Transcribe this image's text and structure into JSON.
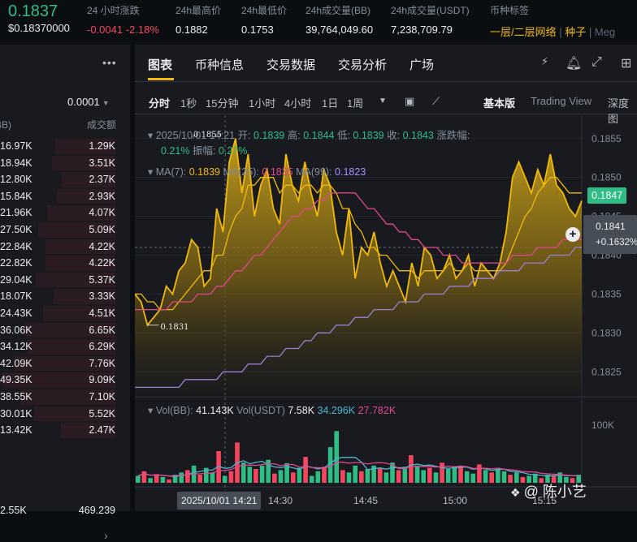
{
  "header": {
    "price": "0.1837",
    "price_usd": "$0.18370000",
    "stats": [
      {
        "label": "24 小时涨跌",
        "value": "-0.0041 -2.18%",
        "tone": "red"
      },
      {
        "label": "24h最高价",
        "value": "0.1882"
      },
      {
        "label": "24h最低价",
        "value": "0.1753"
      },
      {
        "label": "24h成交量(BB)",
        "value": "39,764,049.60"
      },
      {
        "label": "24h成交量(USDT)",
        "value": "7,238,709.79"
      }
    ],
    "tags_label": "币种标签",
    "tags": [
      "一层/二层网络",
      "种子",
      "Meg"
    ]
  },
  "trades": {
    "precision": "0.0001",
    "col_qty": "量(BB)",
    "col_amount": "成交额",
    "rows": [
      {
        "qty": "16.97K",
        "amount": "1.29K"
      },
      {
        "qty": "18.94K",
        "amount": "3.51K"
      },
      {
        "qty": "12.80K",
        "amount": "2.37K"
      },
      {
        "qty": "15.84K",
        "amount": "2.93K"
      },
      {
        "qty": "21.96K",
        "amount": "4.07K"
      },
      {
        "qty": "27.50K",
        "amount": "5.09K"
      },
      {
        "qty": "22.84K",
        "amount": "4.22K"
      },
      {
        "qty": "22.82K",
        "amount": "4.22K"
      },
      {
        "qty": "29.04K",
        "amount": "5.37K"
      },
      {
        "qty": "18.07K",
        "amount": "3.33K"
      },
      {
        "qty": "24.43K",
        "amount": "4.51K"
      },
      {
        "qty": "36.06K",
        "amount": "6.65K"
      },
      {
        "qty": "34.12K",
        "amount": "6.29K"
      },
      {
        "qty": "42.09K",
        "amount": "7.76K"
      },
      {
        "qty": "49.35K",
        "amount": "9.09K"
      },
      {
        "qty": "38.55K",
        "amount": "7.10K"
      },
      {
        "qty": "30.01K",
        "amount": "5.52K"
      },
      {
        "qty": "13.42K",
        "amount": "2.47K"
      }
    ],
    "footer": {
      "qty": "2.55K",
      "amount": "469.239"
    }
  },
  "tabs": [
    "图表",
    "币种信息",
    "交易数据",
    "交易分析",
    "广场"
  ],
  "intervals": [
    "分时",
    "1秒",
    "15分钟",
    "1小时",
    "4小时",
    "1日",
    "1周"
  ],
  "view_modes": [
    "基本版",
    "Trading View",
    "深度图"
  ],
  "ohlc": {
    "date": "2025/10/01 14:21",
    "open_label": "开:",
    "open": "0.1839",
    "high_label": "高:",
    "high": "0.1844",
    "low_label": "低:",
    "low": "0.1839",
    "close_label": "收:",
    "close": "0.1843",
    "change_label": "涨跌幅:",
    "change": "0.21%",
    "amp_label": "振幅:",
    "amp": "0.27%"
  },
  "ma": {
    "ma7_label": "MA(7):",
    "ma7": "0.1839",
    "ma25_label": "MA(25):",
    "ma25": "0.1835",
    "ma99_label": "MA(99):",
    "ma99": "0.1823"
  },
  "vol": {
    "bb_label": "Vol(BB):",
    "bb": "41.143K",
    "usdt_label": "Vol(USDT)",
    "usdt": "7.58K",
    "ma1": "34.296K",
    "ma2": "27.782K"
  },
  "chart_data": {
    "type": "area",
    "y_ticks": [
      "0.1855",
      "0.1850",
      "0.1845",
      "0.1840",
      "0.1835",
      "0.1830",
      "0.1825"
    ],
    "ylim": [
      0.1822,
      0.1858
    ],
    "x_ticks": [
      "14:30",
      "14:45",
      "15:00",
      "15:15"
    ],
    "series": [
      {
        "values": [
          0.1835,
          0.1834,
          0.1831,
          0.1832,
          0.1833,
          0.1836,
          0.1835,
          0.1838,
          0.1839,
          0.1842,
          0.1841,
          0.1836,
          0.1837,
          0.1846,
          0.1843,
          0.1852,
          0.1855,
          0.1848,
          0.1853,
          0.1845,
          0.1849,
          0.1851,
          0.1846,
          0.1844,
          0.1853,
          0.1849,
          0.1847,
          0.1852,
          0.1848,
          0.1845,
          0.1851,
          0.1849,
          0.1843,
          0.184,
          0.1846,
          0.1837,
          0.1841,
          0.184,
          0.1843,
          0.1839,
          0.1836,
          0.1838,
          0.1836,
          0.1834,
          0.1839,
          0.1836,
          0.1841,
          0.184,
          0.1837,
          0.1838,
          0.184,
          0.1837,
          0.1838,
          0.184,
          0.1836,
          0.1839,
          0.1838,
          0.1837,
          0.1839,
          0.1843,
          0.185,
          0.1852,
          0.185,
          0.1848,
          0.1851,
          0.1849,
          0.1853,
          0.1849,
          0.1848,
          0.1846,
          0.1845,
          0.1847
        ]
      },
      {
        "name": "MA(7)",
        "values": [
          0.1835,
          0.1835,
          0.1834,
          0.1834,
          0.1833,
          0.1833,
          0.1833,
          0.1834,
          0.1835,
          0.1836,
          0.1837,
          0.1838,
          0.1838,
          0.184,
          0.184,
          0.1843,
          0.1845,
          0.1846,
          0.1849,
          0.1849,
          0.185,
          0.185,
          0.185,
          0.1848,
          0.1849,
          0.1849,
          0.1848,
          0.1849,
          0.1849,
          0.1848,
          0.1849,
          0.1849,
          0.1848,
          0.1846,
          0.1846,
          0.1844,
          0.1843,
          0.1841,
          0.1841,
          0.184,
          0.184,
          0.1839,
          0.1838,
          0.1838,
          0.1838,
          0.1837,
          0.1838,
          0.1838,
          0.1838,
          0.1838,
          0.1839,
          0.1838,
          0.1838,
          0.1839,
          0.1838,
          0.1838,
          0.1838,
          0.1838,
          0.1838,
          0.1839,
          0.1841,
          0.1843,
          0.1845,
          0.1846,
          0.1848,
          0.1849,
          0.185,
          0.185,
          0.1849,
          0.1848,
          0.1848,
          0.1848
        ]
      },
      {
        "name": "MA(25)",
        "values": [
          0.1833,
          0.1833,
          0.1833,
          0.1833,
          0.1833,
          0.1833,
          0.1834,
          0.1834,
          0.1834,
          0.1834,
          0.1835,
          0.1835,
          0.1835,
          0.1836,
          0.1836,
          0.1837,
          0.1838,
          0.1838,
          0.1839,
          0.184,
          0.184,
          0.1841,
          0.1842,
          0.1843,
          0.1844,
          0.1845,
          0.1845,
          0.1846,
          0.1846,
          0.1847,
          0.1847,
          0.1848,
          0.1848,
          0.1848,
          0.1848,
          0.1848,
          0.1847,
          0.1846,
          0.1846,
          0.1845,
          0.1844,
          0.1844,
          0.1843,
          0.1843,
          0.1842,
          0.1842,
          0.1841,
          0.1841,
          0.1841,
          0.184,
          0.184,
          0.184,
          0.1839,
          0.1839,
          0.1839,
          0.1839,
          0.1839,
          0.1839,
          0.1839,
          0.1839,
          0.184,
          0.184,
          0.184,
          0.184,
          0.1841,
          0.1841,
          0.1841,
          0.1841,
          0.1842,
          0.1842,
          0.1842,
          0.1842
        ]
      },
      {
        "name": "MA(99)",
        "values": [
          0.1823,
          0.1823,
          0.1823,
          0.1823,
          0.1823,
          0.1823,
          0.1823,
          0.1823,
          0.1824,
          0.1824,
          0.1824,
          0.1824,
          0.1824,
          0.1824,
          0.1825,
          0.1825,
          0.1825,
          0.1825,
          0.1826,
          0.1826,
          0.1826,
          0.1827,
          0.1827,
          0.1827,
          0.1828,
          0.1828,
          0.1828,
          0.1829,
          0.1829,
          0.183,
          0.183,
          0.183,
          0.1831,
          0.1831,
          0.1831,
          0.1832,
          0.1832,
          0.1832,
          0.1833,
          0.1833,
          0.1833,
          0.1833,
          0.1834,
          0.1834,
          0.1834,
          0.1834,
          0.1835,
          0.1835,
          0.1835,
          0.1835,
          0.1836,
          0.1836,
          0.1836,
          0.1836,
          0.1837,
          0.1837,
          0.1837,
          0.1837,
          0.1838,
          0.1838,
          0.1838,
          0.1838,
          0.1839,
          0.1839,
          0.1839,
          0.1839,
          0.184,
          0.184,
          0.184,
          0.184,
          0.1841,
          0.1841
        ]
      }
    ],
    "annotations": {
      "high": "0.1855",
      "low": "0.1831"
    },
    "last_price": "0.1847",
    "cross_price": "0.1841",
    "cross_pct": "+0.1632%",
    "cross_time": "2025/10/01 14:21",
    "volume": {
      "ylim": [
        0,
        120
      ],
      "y_tick": "100K",
      "bars": [
        12,
        20,
        8,
        15,
        10,
        6,
        14,
        18,
        22,
        30,
        14,
        26,
        18,
        55,
        12,
        20,
        70,
        35,
        28,
        24,
        30,
        40,
        16,
        22,
        34,
        18,
        26,
        45,
        12,
        20,
        28,
        62,
        90,
        22,
        18,
        30,
        20,
        24,
        30,
        26,
        18,
        35,
        22,
        28,
        48,
        30,
        22,
        26,
        18,
        35,
        24,
        28,
        30,
        20,
        16,
        32,
        22,
        18,
        26,
        20,
        14,
        18,
        10,
        12,
        16,
        8,
        14,
        12,
        18,
        10,
        8,
        14
      ],
      "up": [
        1,
        0,
        1,
        0,
        1,
        0,
        1,
        1,
        0,
        1,
        0,
        1,
        1,
        0,
        1,
        0,
        0,
        1,
        1,
        0,
        1,
        1,
        0,
        1,
        1,
        0,
        1,
        0,
        1,
        1,
        0,
        1,
        1,
        0,
        1,
        1,
        0,
        1,
        1,
        0,
        1,
        1,
        0,
        1,
        0,
        1,
        1,
        0,
        1,
        0,
        1,
        1,
        0,
        1,
        1,
        0,
        1,
        0,
        1,
        1,
        0,
        1,
        0,
        1,
        1,
        0,
        1,
        0,
        1,
        1,
        0,
        1
      ]
    }
  },
  "watermark": "@ 陈小艺"
}
